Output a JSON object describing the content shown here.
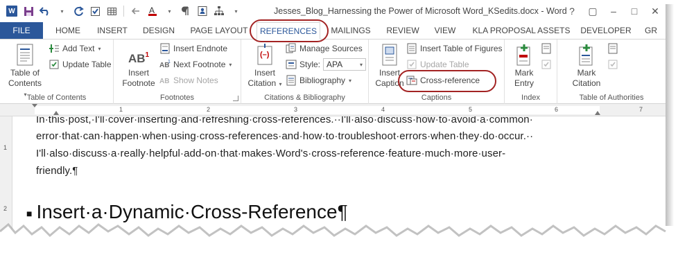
{
  "window": {
    "title": "Jesses_Blog_Harnessing the Power of Microsoft Word_KSedits.docx - Word",
    "help": "?",
    "restore": "▢",
    "minimize": "–",
    "maximize": "□",
    "close": "✕"
  },
  "tabs": [
    {
      "label": "FILE"
    },
    {
      "label": "HOME"
    },
    {
      "label": "INSERT"
    },
    {
      "label": "DESIGN"
    },
    {
      "label": "PAGE LAYOUT"
    },
    {
      "label": "REFERENCES",
      "active": true
    },
    {
      "label": "MAILINGS"
    },
    {
      "label": "REVIEW"
    },
    {
      "label": "VIEW"
    },
    {
      "label": "KLA PROPOSAL ASSETS"
    },
    {
      "label": "DEVELOPER"
    },
    {
      "label": "GR"
    }
  ],
  "ribbon": {
    "toc": {
      "table_of_contents": "Table of",
      "table_of_contents_line2": "Contents",
      "add_text": "Add Text",
      "update_table": "Update Table",
      "group_label": "Table of Contents"
    },
    "footnotes": {
      "insert_footnote": "Insert",
      "insert_footnote_line2": "Footnote",
      "insert_endnote": "Insert Endnote",
      "next_footnote": "Next Footnote",
      "show_notes": "Show Notes",
      "group_label": "Footnotes",
      "icon_text": "AB",
      "icon_sup": "1"
    },
    "citations": {
      "insert_citation": "Insert",
      "insert_citation_line2": "Citation",
      "manage_sources": "Manage Sources",
      "style_label": "Style:",
      "style_value": "APA",
      "bibliography": "Bibliography",
      "group_label": "Citations & Bibliography"
    },
    "captions": {
      "insert_caption": "Insert",
      "insert_caption_line2": "Caption",
      "insert_table_of_figures": "Insert Table of Figures",
      "update_table": "Update Table",
      "cross_reference": "Cross-reference",
      "group_label": "Captions"
    },
    "index": {
      "mark_entry": "Mark",
      "mark_entry_line2": "Entry",
      "group_label": "Index"
    },
    "authorities": {
      "mark_citation": "Mark",
      "mark_citation_line2": "Citation",
      "group_label": "Table of Authorities"
    }
  },
  "ruler": {
    "numbers": [
      "1",
      "2",
      "3",
      "4",
      "5",
      "6",
      "7"
    ],
    "vertical_numbers": [
      "1",
      "2"
    ]
  },
  "document": {
    "line1": "In·this·post,·I'll·cover·inserting·and·refreshing·cross-references.··I'll·also·discuss·how·to·avoid·a·common·",
    "line2": "error·that·can·happen·when·using·cross-references·and·how·to·troubleshoot·errors·when·they·do·occur.··",
    "line3": "I'll·also·discuss·a·really·helpful·add-on·that·makes·Word's·cross-reference·feature·much·more·user-",
    "line4": "friendly.¶",
    "heading": "Insert·a·Dynamic·Cross-Reference¶",
    "heading_mark": "■"
  },
  "colors": {
    "word_blue": "#2b579a",
    "highlight_red": "#a32323"
  }
}
